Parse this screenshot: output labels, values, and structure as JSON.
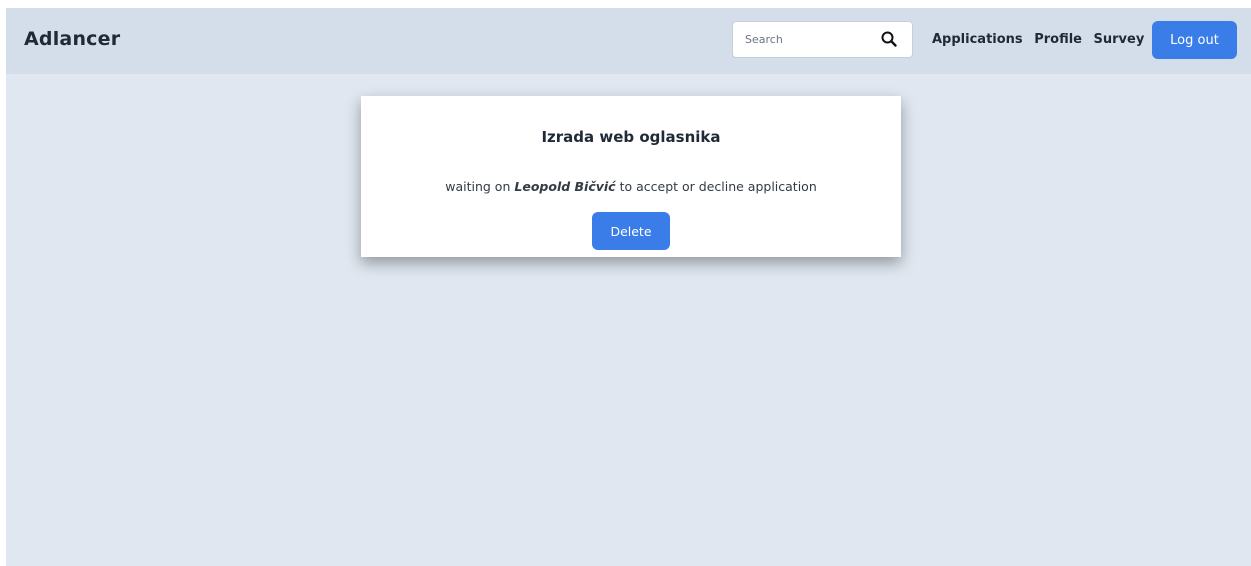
{
  "navbar": {
    "brand": "Adlancer",
    "search": {
      "placeholder": "Search",
      "value": ""
    },
    "links": [
      "Applications",
      "Profile",
      "Survey"
    ],
    "logout_label": "Log out"
  },
  "application": {
    "title": "Izrada web oglasnika",
    "status_prefix": "waiting on",
    "person": "Leopold Bičvić",
    "status_suffix": "to accept or decline application",
    "delete_label": "Delete"
  },
  "colors": {
    "navbar_bg": "#d3deea",
    "page_bg": "#e0e7f0",
    "accent": "#3a7de8"
  }
}
